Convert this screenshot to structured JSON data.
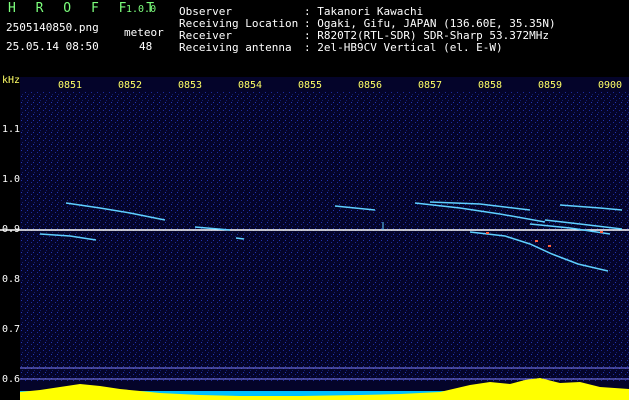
{
  "app": {
    "name": "H R O F F T",
    "version": "1.0.0"
  },
  "file": {
    "name": "2505140850.png",
    "datetime": "25.05.14 08:50"
  },
  "meteor": {
    "label": "meteor",
    "count": "48"
  },
  "info": [
    {
      "key": "Observer",
      "value": ": Takanori Kawachi"
    },
    {
      "key": "Receiving Location",
      "value": ": Ogaki, Gifu, JAPAN (136.60E, 35.35N)"
    },
    {
      "key": "Receiver",
      "value": ": R820T2(RTL-SDR) SDR-Sharp 53.372MHz"
    },
    {
      "key": "Receiving antenna",
      "value": ": 2el-HB9CV Vertical (el. E-W)"
    }
  ],
  "axis": {
    "y_unit": "kHz",
    "x_ticks": [
      "0851",
      "0852",
      "0853",
      "0854",
      "0855",
      "0856",
      "0857",
      "0858",
      "0859",
      "0900"
    ],
    "y_ticks": [
      "1.1",
      "1.0",
      "0.9",
      "0.8",
      "0.7",
      "0.6"
    ]
  },
  "colors": {
    "carrier": "#ffffff",
    "trace": "#5fd0ff",
    "signal": "#ffff00",
    "background": "#04042a",
    "tick_text": "#ffff66"
  }
}
